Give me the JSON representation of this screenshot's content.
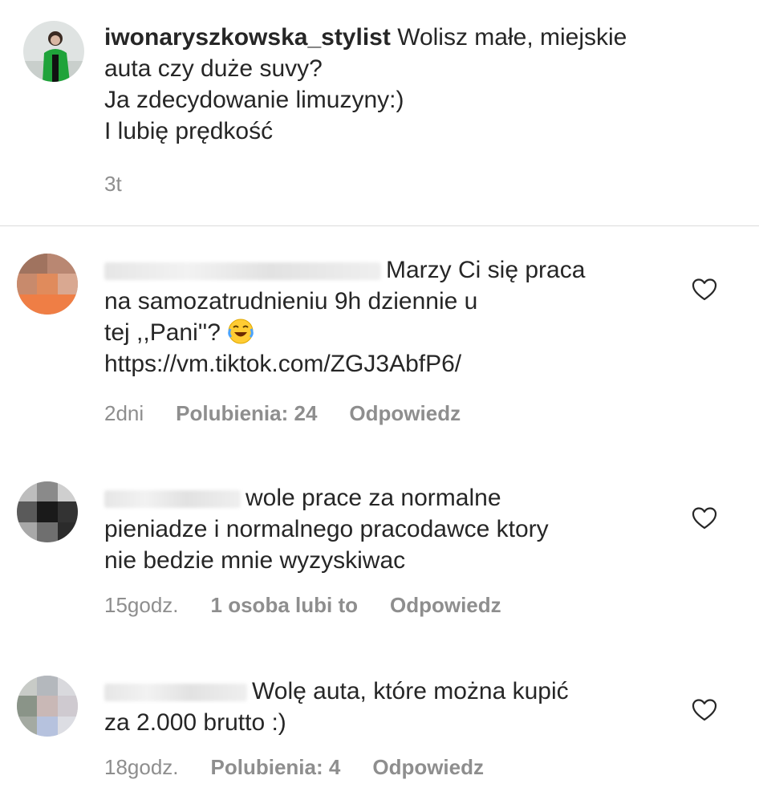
{
  "caption": {
    "username": "iwonaryszkowska_stylist",
    "lines": [
      "Wolisz małe, miejskie",
      "auta czy duże suvy?",
      "Ja zdecydowanie limuzyny:)",
      "I lubię prędkość"
    ],
    "time": "3t"
  },
  "comments": [
    {
      "lines": [
        "Marzy Ci się praca",
        "na samozatrudnieniu 9h dziennie u",
        "tej ,,Pani''? ",
        "https://vm.tiktok.com/ZGJ3AbfP6/"
      ],
      "emoji": "face-with-tears-of-joy",
      "time": "2dni",
      "likes": "Polubienia: 24",
      "reply": "Odpowiedz"
    },
    {
      "lines": [
        "wole prace za normalne",
        "pieniadze i normalnego pracodawce ktory",
        "nie bedzie mnie wyzyskiwac"
      ],
      "time": "15godz.",
      "likes": "1 osoba lubi to",
      "reply": "Odpowiedz"
    },
    {
      "lines": [
        "Wolę auta, które można kupić",
        "za 2.000 brutto :)"
      ],
      "time": "18godz.",
      "likes": "Polubienia: 4",
      "reply": "Odpowiedz"
    }
  ],
  "icons": {
    "like": "heart-outline-icon",
    "emoji": "face-with-tears-of-joy"
  },
  "colors": {
    "text": "#262626",
    "meta": "#8e8e8e",
    "divider": "#dbdbdb"
  }
}
